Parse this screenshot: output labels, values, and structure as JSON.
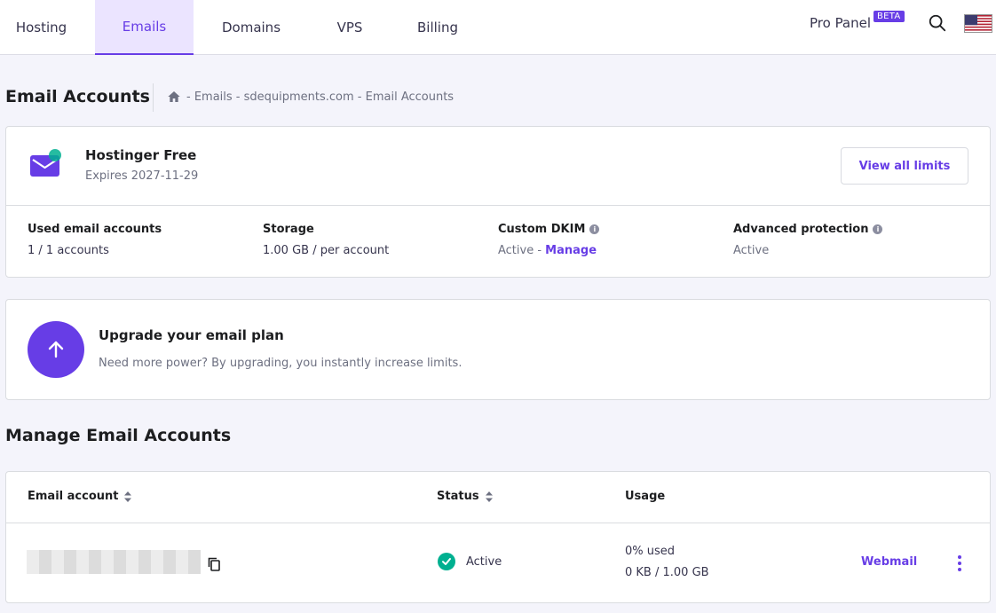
{
  "nav": {
    "tabs": [
      {
        "label": "Hosting"
      },
      {
        "label": "Emails"
      },
      {
        "label": "Domains"
      },
      {
        "label": "VPS"
      },
      {
        "label": "Billing"
      }
    ],
    "active_tab": "Emails",
    "pro_panel": "Pro Panel",
    "beta_badge": "BETA"
  },
  "header": {
    "title": "Email Accounts",
    "breadcrumb": "- Emails - sdequipments.com - Email Accounts"
  },
  "plan": {
    "name": "Hostinger Free",
    "expires": "Expires 2027-11-29",
    "view_limits": "View all limits",
    "stats": [
      {
        "label": "Used email accounts",
        "value": "1 / 1 accounts"
      },
      {
        "label": "Storage",
        "value": "1.00 GB / per account"
      },
      {
        "label": "Custom DKIM",
        "value_prefix": "Active - ",
        "link": "Manage"
      },
      {
        "label": "Advanced protection",
        "value": "Active"
      }
    ]
  },
  "upgrade": {
    "title": "Upgrade your email plan",
    "description": "Need more power? By upgrading, you instantly increase limits."
  },
  "manage": {
    "title": "Manage Email Accounts",
    "columns": {
      "email": "Email account",
      "status": "Status",
      "usage": "Usage"
    },
    "rows": [
      {
        "status": "Active",
        "usage_percent": "0% used",
        "usage_amount": "0 KB / 1.00 GB",
        "action": "Webmail"
      }
    ]
  },
  "colors": {
    "accent": "#673de6",
    "success": "#00b090"
  }
}
